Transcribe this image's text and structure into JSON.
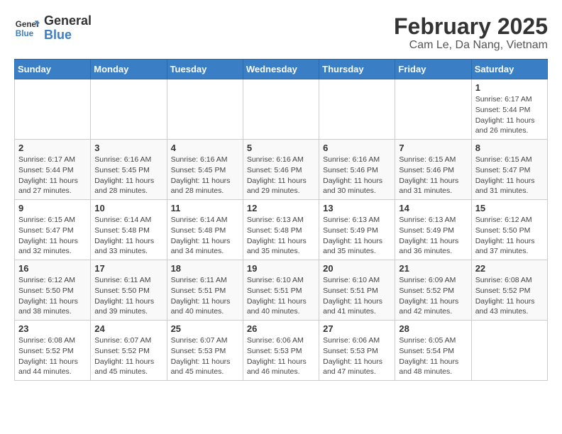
{
  "logo": {
    "text_general": "General",
    "text_blue": "Blue"
  },
  "title": "February 2025",
  "subtitle": "Cam Le, Da Nang, Vietnam",
  "days_header": [
    "Sunday",
    "Monday",
    "Tuesday",
    "Wednesday",
    "Thursday",
    "Friday",
    "Saturday"
  ],
  "weeks": [
    [
      {
        "day": "",
        "info": ""
      },
      {
        "day": "",
        "info": ""
      },
      {
        "day": "",
        "info": ""
      },
      {
        "day": "",
        "info": ""
      },
      {
        "day": "",
        "info": ""
      },
      {
        "day": "",
        "info": ""
      },
      {
        "day": "1",
        "info": "Sunrise: 6:17 AM\nSunset: 5:44 PM\nDaylight: 11 hours and 26 minutes."
      }
    ],
    [
      {
        "day": "2",
        "info": "Sunrise: 6:17 AM\nSunset: 5:44 PM\nDaylight: 11 hours and 27 minutes."
      },
      {
        "day": "3",
        "info": "Sunrise: 6:16 AM\nSunset: 5:45 PM\nDaylight: 11 hours and 28 minutes."
      },
      {
        "day": "4",
        "info": "Sunrise: 6:16 AM\nSunset: 5:45 PM\nDaylight: 11 hours and 28 minutes."
      },
      {
        "day": "5",
        "info": "Sunrise: 6:16 AM\nSunset: 5:46 PM\nDaylight: 11 hours and 29 minutes."
      },
      {
        "day": "6",
        "info": "Sunrise: 6:16 AM\nSunset: 5:46 PM\nDaylight: 11 hours and 30 minutes."
      },
      {
        "day": "7",
        "info": "Sunrise: 6:15 AM\nSunset: 5:46 PM\nDaylight: 11 hours and 31 minutes."
      },
      {
        "day": "8",
        "info": "Sunrise: 6:15 AM\nSunset: 5:47 PM\nDaylight: 11 hours and 31 minutes."
      }
    ],
    [
      {
        "day": "9",
        "info": "Sunrise: 6:15 AM\nSunset: 5:47 PM\nDaylight: 11 hours and 32 minutes."
      },
      {
        "day": "10",
        "info": "Sunrise: 6:14 AM\nSunset: 5:48 PM\nDaylight: 11 hours and 33 minutes."
      },
      {
        "day": "11",
        "info": "Sunrise: 6:14 AM\nSunset: 5:48 PM\nDaylight: 11 hours and 34 minutes."
      },
      {
        "day": "12",
        "info": "Sunrise: 6:13 AM\nSunset: 5:48 PM\nDaylight: 11 hours and 35 minutes."
      },
      {
        "day": "13",
        "info": "Sunrise: 6:13 AM\nSunset: 5:49 PM\nDaylight: 11 hours and 35 minutes."
      },
      {
        "day": "14",
        "info": "Sunrise: 6:13 AM\nSunset: 5:49 PM\nDaylight: 11 hours and 36 minutes."
      },
      {
        "day": "15",
        "info": "Sunrise: 6:12 AM\nSunset: 5:50 PM\nDaylight: 11 hours and 37 minutes."
      }
    ],
    [
      {
        "day": "16",
        "info": "Sunrise: 6:12 AM\nSunset: 5:50 PM\nDaylight: 11 hours and 38 minutes."
      },
      {
        "day": "17",
        "info": "Sunrise: 6:11 AM\nSunset: 5:50 PM\nDaylight: 11 hours and 39 minutes."
      },
      {
        "day": "18",
        "info": "Sunrise: 6:11 AM\nSunset: 5:51 PM\nDaylight: 11 hours and 40 minutes."
      },
      {
        "day": "19",
        "info": "Sunrise: 6:10 AM\nSunset: 5:51 PM\nDaylight: 11 hours and 40 minutes."
      },
      {
        "day": "20",
        "info": "Sunrise: 6:10 AM\nSunset: 5:51 PM\nDaylight: 11 hours and 41 minutes."
      },
      {
        "day": "21",
        "info": "Sunrise: 6:09 AM\nSunset: 5:52 PM\nDaylight: 11 hours and 42 minutes."
      },
      {
        "day": "22",
        "info": "Sunrise: 6:08 AM\nSunset: 5:52 PM\nDaylight: 11 hours and 43 minutes."
      }
    ],
    [
      {
        "day": "23",
        "info": "Sunrise: 6:08 AM\nSunset: 5:52 PM\nDaylight: 11 hours and 44 minutes."
      },
      {
        "day": "24",
        "info": "Sunrise: 6:07 AM\nSunset: 5:52 PM\nDaylight: 11 hours and 45 minutes."
      },
      {
        "day": "25",
        "info": "Sunrise: 6:07 AM\nSunset: 5:53 PM\nDaylight: 11 hours and 45 minutes."
      },
      {
        "day": "26",
        "info": "Sunrise: 6:06 AM\nSunset: 5:53 PM\nDaylight: 11 hours and 46 minutes."
      },
      {
        "day": "27",
        "info": "Sunrise: 6:06 AM\nSunset: 5:53 PM\nDaylight: 11 hours and 47 minutes."
      },
      {
        "day": "28",
        "info": "Sunrise: 6:05 AM\nSunset: 5:54 PM\nDaylight: 11 hours and 48 minutes."
      },
      {
        "day": "",
        "info": ""
      }
    ]
  ]
}
